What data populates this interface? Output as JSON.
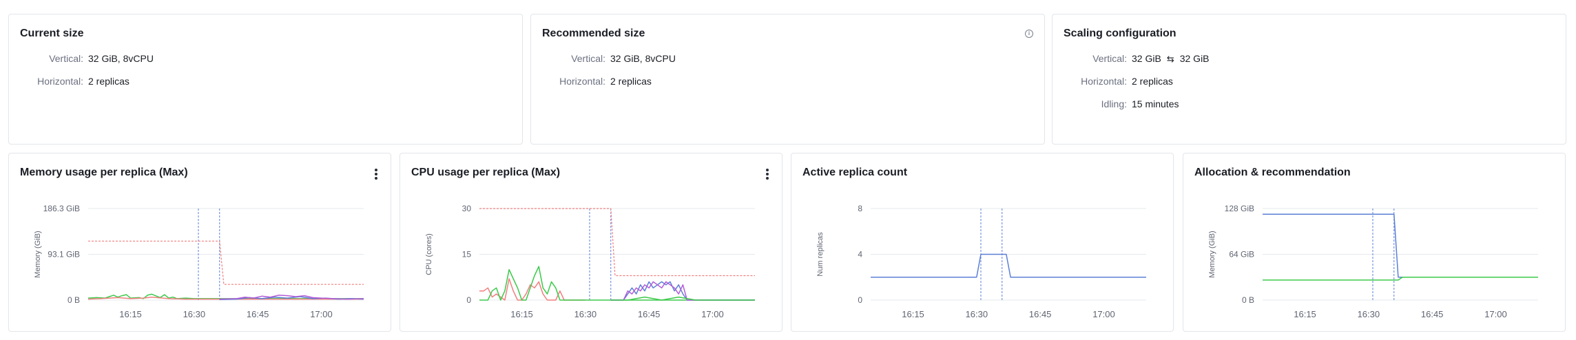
{
  "current_size": {
    "title": "Current size",
    "vertical_label": "Vertical:",
    "vertical_value": "32 GiB, 8vCPU",
    "horizontal_label": "Horizontal:",
    "horizontal_value": "2 replicas"
  },
  "recommended_size": {
    "title": "Recommended size",
    "info_icon": "info-icon",
    "vertical_label": "Vertical:",
    "vertical_value": "32 GiB, 8vCPU",
    "horizontal_label": "Horizontal:",
    "horizontal_value": "2 replicas"
  },
  "scaling_configuration": {
    "title": "Scaling configuration",
    "vertical_label": "Vertical:",
    "vertical_min": "32 GiB",
    "vertical_swap_icon": "swap-arrows-icon",
    "vertical_max": "32 GiB",
    "horizontal_label": "Horizontal:",
    "horizontal_value": "2 replicas",
    "idling_label": "Idling:",
    "idling_value": "15 minutes"
  },
  "colors": {
    "red": "#f07f7f",
    "blue": "#5b7fd6",
    "green": "#3cc94a",
    "purple": "#b35ad8",
    "grid": "#e6e8ec",
    "axis_text": "#5f6472"
  },
  "chart_data": [
    {
      "type": "line",
      "title": "Memory usage per replica (Max)",
      "menu_icon": "kebab-menu-icon",
      "ylabel": "Memory (GiB)",
      "yticks": [
        "0 B",
        "93.1 GiB",
        "186.3 GiB"
      ],
      "ylim": [
        0,
        186.3
      ],
      "xticks": [
        "16:15",
        "16:30",
        "16:45",
        "17:00"
      ],
      "xlim": [
        "16:05",
        "17:10"
      ],
      "markers": [
        "16:31",
        "16:36"
      ],
      "series": [
        {
          "color": "#f07f7f",
          "dashed": true,
          "x": [
            "16:05",
            "16:36",
            "16:37",
            "17:10"
          ],
          "y": [
            120,
            120,
            32,
            32
          ]
        },
        {
          "color": "#3cc94a",
          "x": [
            "16:05",
            "16:07",
            "16:09",
            "16:10",
            "16:11",
            "16:12",
            "16:13",
            "16:14",
            "16:15",
            "16:17",
            "16:18",
            "16:19",
            "16:20",
            "16:22",
            "16:23",
            "16:24",
            "16:25",
            "16:26",
            "16:28",
            "16:30",
            "16:35",
            "16:40",
            "17:10"
          ],
          "y": [
            4,
            5,
            4,
            7,
            10,
            6,
            9,
            11,
            4,
            5,
            3,
            10,
            12,
            5,
            11,
            4,
            6,
            3,
            4,
            3,
            3,
            3,
            3
          ]
        },
        {
          "color": "#f07f7f",
          "x": [
            "16:05",
            "16:08",
            "16:12",
            "16:15",
            "16:18",
            "16:20",
            "16:24",
            "16:28",
            "16:32",
            "17:10"
          ],
          "y": [
            2,
            3,
            5,
            3,
            4,
            6,
            3,
            2,
            2,
            2
          ]
        },
        {
          "color": "#5b7fd6",
          "x": [
            "16:36",
            "16:40",
            "16:43",
            "16:46",
            "16:49",
            "16:52",
            "16:55",
            "16:58",
            "17:01",
            "17:04",
            "17:07",
            "17:10"
          ],
          "y": [
            1,
            2,
            5,
            3,
            6,
            4,
            7,
            3,
            4,
            2,
            3,
            2
          ]
        },
        {
          "color": "#b35ad8",
          "x": [
            "16:36",
            "16:40",
            "16:42",
            "16:44",
            "16:46",
            "16:48",
            "16:50",
            "16:52",
            "16:54",
            "16:56",
            "16:58",
            "17:00",
            "17:03",
            "17:06",
            "17:10"
          ],
          "y": [
            2,
            3,
            6,
            4,
            8,
            6,
            10,
            9,
            7,
            9,
            5,
            4,
            3,
            2,
            3
          ]
        }
      ]
    },
    {
      "type": "line",
      "title": "CPU usage per replica (Max)",
      "menu_icon": "kebab-menu-icon",
      "ylabel": "CPU (cores)",
      "yticks": [
        "0",
        "15",
        "30"
      ],
      "ylim": [
        0,
        30
      ],
      "xticks": [
        "16:15",
        "16:30",
        "16:45",
        "17:00"
      ],
      "xlim": [
        "16:05",
        "17:10"
      ],
      "markers": [
        "16:31",
        "16:36"
      ],
      "series": [
        {
          "color": "#f07f7f",
          "dashed": true,
          "x": [
            "16:05",
            "16:36",
            "16:37",
            "17:10"
          ],
          "y": [
            30,
            30,
            8,
            8
          ]
        },
        {
          "color": "#f07f7f",
          "x": [
            "16:05",
            "16:06",
            "16:07",
            "16:08",
            "16:09",
            "16:10",
            "16:11",
            "16:12",
            "16:13",
            "16:14",
            "16:15",
            "16:16",
            "16:17",
            "16:18",
            "16:19",
            "16:20",
            "16:21",
            "16:22",
            "16:23",
            "16:24",
            "16:25",
            "16:26",
            "16:27",
            "16:28",
            "16:29",
            "16:30"
          ],
          "y": [
            3,
            3,
            4,
            1,
            2,
            1,
            0,
            7,
            3,
            0,
            0,
            2,
            5,
            4,
            6,
            2,
            0,
            0,
            0,
            3,
            0,
            0,
            0,
            0,
            0,
            0
          ]
        },
        {
          "color": "#3cc94a",
          "x": [
            "16:05",
            "16:07",
            "16:08",
            "16:09",
            "16:10",
            "16:11",
            "16:12",
            "16:13",
            "16:14",
            "16:15",
            "16:16",
            "16:17",
            "16:18",
            "16:19",
            "16:20",
            "16:21",
            "16:22",
            "16:23",
            "16:24",
            "16:25",
            "16:26",
            "16:27",
            "16:28",
            "16:30",
            "17:10"
          ],
          "y": [
            0,
            0,
            3,
            4,
            0,
            3,
            10,
            7,
            4,
            0,
            0,
            4,
            8,
            11,
            4,
            2,
            6,
            4,
            0,
            0,
            0,
            0,
            0,
            0,
            0
          ]
        },
        {
          "color": "#5b7fd6",
          "x": [
            "16:36",
            "16:39",
            "16:40",
            "16:41",
            "16:42",
            "16:43",
            "16:44",
            "16:45",
            "16:46",
            "16:47",
            "16:48",
            "16:49",
            "16:50",
            "16:51",
            "16:52",
            "16:53",
            "16:54",
            "17:10"
          ],
          "y": [
            0,
            0,
            2,
            4,
            2,
            5,
            3,
            6,
            4,
            5,
            6,
            5,
            6,
            3,
            5,
            2,
            0,
            0
          ]
        },
        {
          "color": "#b35ad8",
          "x": [
            "16:36",
            "16:39",
            "16:40",
            "16:41",
            "16:42",
            "16:43",
            "16:44",
            "16:45",
            "16:46",
            "16:47",
            "16:48",
            "16:49",
            "16:50",
            "16:51",
            "16:52",
            "16:53",
            "16:54",
            "17:10"
          ],
          "y": [
            0,
            0,
            3,
            2,
            4,
            3,
            5,
            4,
            6,
            5,
            4,
            6,
            5,
            4,
            2,
            5,
            0,
            0
          ]
        },
        {
          "color": "#3cc94a",
          "x": [
            "16:36",
            "16:40",
            "16:44",
            "16:48",
            "16:52",
            "16:56",
            "17:10"
          ],
          "y": [
            0,
            0,
            1,
            0,
            1,
            0,
            0
          ]
        }
      ]
    },
    {
      "type": "line",
      "title": "Active replica count",
      "ylabel": "Num replicas",
      "yticks": [
        "0",
        "4",
        "8"
      ],
      "ylim": [
        0,
        8
      ],
      "xticks": [
        "16:15",
        "16:30",
        "16:45",
        "17:00"
      ],
      "xlim": [
        "16:05",
        "17:10"
      ],
      "markers": [
        "16:31",
        "16:36"
      ],
      "series": [
        {
          "color": "#5b7fd6",
          "x": [
            "16:05",
            "16:30",
            "16:31",
            "16:37",
            "16:38",
            "17:10"
          ],
          "y": [
            2,
            2,
            4,
            4,
            2,
            2
          ]
        }
      ]
    },
    {
      "type": "line",
      "title": "Allocation & recommendation",
      "ylabel": "Memory (GiB)",
      "yticks": [
        "0 B",
        "64 GiB",
        "128 GiB"
      ],
      "ylim": [
        0,
        128
      ],
      "xticks": [
        "16:15",
        "16:30",
        "16:45",
        "17:00"
      ],
      "xlim": [
        "16:05",
        "17:10"
      ],
      "markers": [
        "16:31",
        "16:36"
      ],
      "series": [
        {
          "color": "#5b7fd6",
          "x": [
            "16:05",
            "16:36",
            "16:37",
            "17:10"
          ],
          "y": [
            120,
            120,
            32,
            32
          ]
        },
        {
          "color": "#3cc94a",
          "x": [
            "16:05",
            "16:37",
            "16:38",
            "17:10"
          ],
          "y": [
            28,
            28,
            32,
            32
          ]
        }
      ]
    }
  ]
}
